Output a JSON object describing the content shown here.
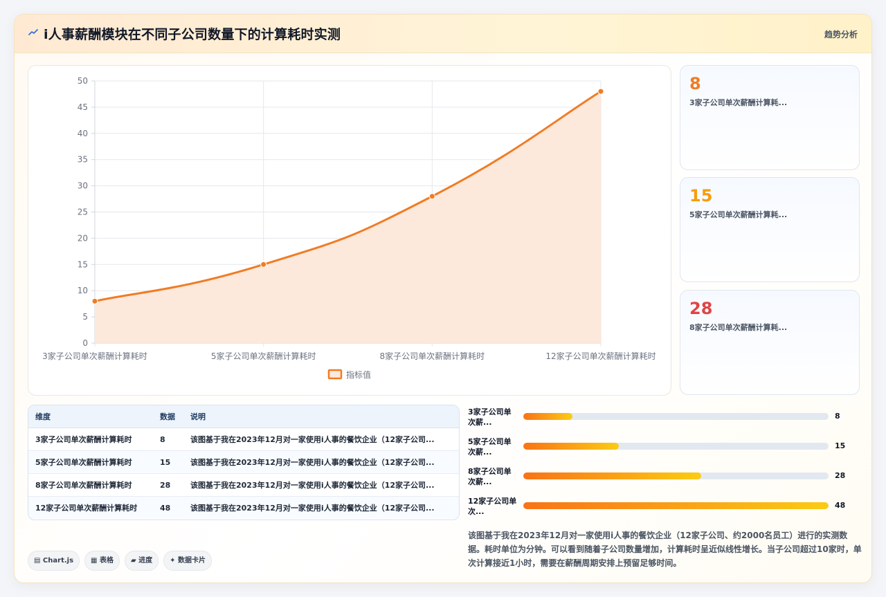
{
  "header": {
    "icon": "trend-icon",
    "title": "i人事薪酬模块在不同子公司数量下的计算耗时实测",
    "right_label": "趋势分析"
  },
  "chart_data": {
    "type": "area",
    "categories": [
      "3家子公司单次薪酬计算耗时",
      "5家子公司单次薪酬计算耗时",
      "8家子公司单次薪酬计算耗时",
      "12家子公司单次薪酬计算耗时"
    ],
    "series": [
      {
        "name": "指标值",
        "values": [
          8,
          15,
          28,
          48
        ]
      }
    ],
    "ylim": [
      0,
      50
    ],
    "yticks": [
      0,
      5,
      10,
      15,
      20,
      25,
      30,
      35,
      40,
      45,
      50
    ],
    "grid": true,
    "legend": "bottom",
    "line_color": "#f07c24",
    "fill_color": "#fde8dc"
  },
  "stats": [
    {
      "value": "8",
      "label": "3家子公司单次薪酬计算耗...",
      "color": "#f07c24"
    },
    {
      "value": "15",
      "label": "5家子公司单次薪酬计算耗...",
      "color": "#f59e0b"
    },
    {
      "value": "28",
      "label": "8家子公司单次薪酬计算耗...",
      "color": "#e04545"
    }
  ],
  "table": {
    "headers": [
      "维度",
      "数据",
      "说明"
    ],
    "rows": [
      [
        "3家子公司单次薪酬计算耗时",
        "8",
        "该图基于我在2023年12月对一家使用i人事的餐饮企业（12家子公司..."
      ],
      [
        "5家子公司单次薪酬计算耗时",
        "15",
        "该图基于我在2023年12月对一家使用i人事的餐饮企业（12家子公司..."
      ],
      [
        "8家子公司单次薪酬计算耗时",
        "28",
        "该图基于我在2023年12月对一家使用i人事的餐饮企业（12家子公司..."
      ],
      [
        "12家子公司单次薪酬计算耗时",
        "48",
        "该图基于我在2023年12月对一家使用i人事的餐饮企业（12家子公司..."
      ]
    ]
  },
  "progress": [
    {
      "label": "3家子公司单次薪...",
      "value": "8",
      "fraction": 0.16
    },
    {
      "label": "5家子公司单次薪...",
      "value": "15",
      "fraction": 0.3125
    },
    {
      "label": "8家子公司单次薪...",
      "value": "28",
      "fraction": 0.583
    },
    {
      "label": "12家子公司单次...",
      "value": "48",
      "fraction": 1.0
    }
  ],
  "description": "该图基于我在2023年12月对一家使用i人事的餐饮企业（12家子公司、约2000名员工）进行的实测数据。耗时单位为分钟。可以看到随着子公司数量增加，计算耗时呈近似线性增长。当子公司超过10家时，单次计算接近1小时，需要在薪酬周期安排上预留足够时间。",
  "tags": [
    "▤ Chart.js",
    "▦ 表格",
    "▰ 进度",
    "✦ 数据卡片"
  ]
}
